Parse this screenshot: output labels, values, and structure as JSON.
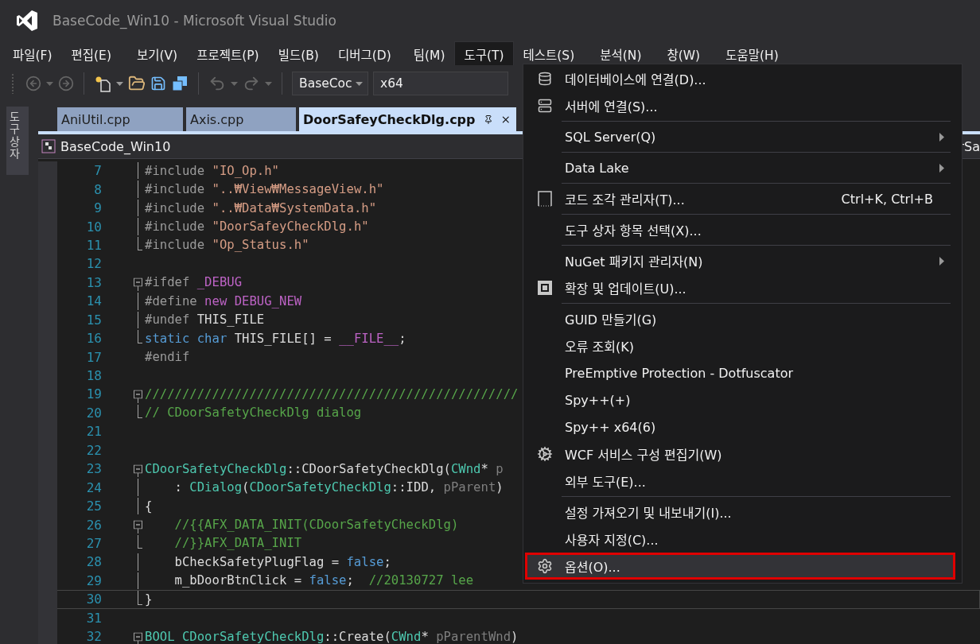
{
  "window": {
    "title": "BaseCode_Win10 - Microsoft Visual Studio"
  },
  "menu_bar": [
    {
      "label": "파일(F)",
      "selected": false
    },
    {
      "label": "편집(E)",
      "selected": false
    },
    {
      "label": "보기(V)",
      "selected": false
    },
    {
      "label": "프로젝트(P)",
      "selected": false
    },
    {
      "label": "빌드(B)",
      "selected": false
    },
    {
      "label": "디버그(D)",
      "selected": false
    },
    {
      "label": "팀(M)",
      "selected": false
    },
    {
      "label": "도구(T)",
      "selected": true
    },
    {
      "label": "테스트(S)",
      "selected": false
    },
    {
      "label": "분석(N)",
      "selected": false
    },
    {
      "label": "창(W)",
      "selected": false
    },
    {
      "label": "도움말(H)",
      "selected": false
    }
  ],
  "toolbar": {
    "solution_combo": "BaseCoc",
    "platform_combo": "x64"
  },
  "side_panel": {
    "label": "도구 상자"
  },
  "doc_tabs": [
    {
      "label": "AniUtil.cpp",
      "selected": false
    },
    {
      "label": "Axis.cpp",
      "selected": false
    },
    {
      "label": "DoorSafeyCheckDlg.cpp",
      "selected": true
    }
  ],
  "nav_bar": {
    "project": "BaseCode_Win10",
    "member": "rSa"
  },
  "code_lines": [
    {
      "number": "7",
      "kind": "mid",
      "current": false,
      "segments": [
        {
          "kind": "preproc",
          "text": "#include "
        },
        {
          "kind": "string",
          "text": "\"IO_Op.h\""
        }
      ]
    },
    {
      "number": "8",
      "kind": "mid",
      "current": false,
      "segments": [
        {
          "kind": "preproc",
          "text": "#include "
        },
        {
          "kind": "string",
          "text": "\"..₩View₩MessageView.h\""
        }
      ]
    },
    {
      "number": "9",
      "kind": "mid",
      "current": false,
      "segments": [
        {
          "kind": "preproc",
          "text": "#include "
        },
        {
          "kind": "string",
          "text": "\"..₩Data₩SystemData.h\""
        }
      ]
    },
    {
      "number": "10",
      "kind": "mid",
      "current": false,
      "segments": [
        {
          "kind": "preproc",
          "text": "#include "
        },
        {
          "kind": "string",
          "text": "\"DoorSafeyCheckDlg.h\""
        }
      ]
    },
    {
      "number": "11",
      "kind": "end",
      "current": false,
      "segments": [
        {
          "kind": "preproc",
          "text": "#include "
        },
        {
          "kind": "string",
          "text": "\"Op_Status.h\""
        }
      ]
    },
    {
      "number": "12",
      "kind": "plain",
      "current": false
    },
    {
      "number": "13",
      "kind": "start",
      "current": false,
      "segments": [
        {
          "kind": "preproc",
          "text": "#ifdef "
        },
        {
          "kind": "macro",
          "text": "_DEBUG"
        }
      ]
    },
    {
      "number": "14",
      "kind": "mid",
      "current": false,
      "segments": [
        {
          "kind": "preproc",
          "text": "#define "
        },
        {
          "kind": "macro",
          "text": "new"
        },
        {
          "kind": "macro",
          "text": " DEBUG_NEW"
        }
      ]
    },
    {
      "number": "15",
      "kind": "mid",
      "current": false,
      "segments": [
        {
          "kind": "preproc",
          "text": "#undef "
        },
        {
          "kind": "plain",
          "text": "THIS_FILE"
        }
      ]
    },
    {
      "number": "16",
      "kind": "end",
      "current": false,
      "segments": [
        {
          "kind": "keyword",
          "text": "static"
        },
        {
          "kind": "keyword",
          "text": " char"
        },
        {
          "kind": "plain",
          "text": " THIS_FILE[] = "
        },
        {
          "kind": "macro",
          "text": "__FILE__"
        },
        {
          "kind": "plain",
          "text": ";"
        }
      ]
    },
    {
      "number": "17",
      "kind": "plain",
      "current": false,
      "segments": [
        {
          "kind": "preproc",
          "text": "#endif"
        }
      ]
    },
    {
      "number": "18",
      "kind": "plain",
      "current": false
    },
    {
      "number": "19",
      "kind": "start",
      "current": false,
      "segments": [
        {
          "kind": "comment",
          "text": "//////////////////////////////////////////////////"
        }
      ]
    },
    {
      "number": "20",
      "kind": "end",
      "current": false,
      "segments": [
        {
          "kind": "comment",
          "text": "// CDoorSafetyCheckDlg dialog"
        }
      ]
    },
    {
      "number": "21",
      "kind": "plain",
      "current": false
    },
    {
      "number": "22",
      "kind": "plain",
      "current": false
    },
    {
      "number": "23",
      "kind": "start",
      "current": false,
      "segments": [
        {
          "kind": "type",
          "text": "CDoorSafetyCheckDlg"
        },
        {
          "kind": "plain",
          "text": "::CDoorSafetyCheckDlg("
        },
        {
          "kind": "type",
          "text": "CWnd"
        },
        {
          "kind": "plain",
          "text": "* "
        },
        {
          "kind": "param",
          "text": "p"
        }
      ]
    },
    {
      "number": "24",
      "kind": "mid",
      "current": false,
      "segments": [
        {
          "kind": "plain",
          "text": "    : "
        },
        {
          "kind": "type",
          "text": "CDialog"
        },
        {
          "kind": "plain",
          "text": "("
        },
        {
          "kind": "type",
          "text": "CDoorSafetyCheckDlg"
        },
        {
          "kind": "plain",
          "text": "::IDD, "
        },
        {
          "kind": "param",
          "text": "pParent"
        },
        {
          "kind": "plain",
          "text": ")"
        }
      ]
    },
    {
      "number": "25",
      "kind": "mid",
      "current": false,
      "segments": [
        {
          "kind": "plain",
          "text": "{"
        }
      ]
    },
    {
      "number": "26",
      "kind": "start",
      "current": false,
      "segments": [
        {
          "kind": "comment",
          "text": "    //{{AFX_DATA_INIT(CDoorSafetyCheckDlg)"
        }
      ]
    },
    {
      "number": "27",
      "kind": "end",
      "current": false,
      "segments": [
        {
          "kind": "comment",
          "text": "    //}}AFX_DATA_INIT"
        }
      ]
    },
    {
      "number": "28",
      "kind": "mid",
      "current": false,
      "segments": [
        {
          "kind": "plain",
          "text": "    bCheckSafetyPlugFlag = "
        },
        {
          "kind": "keyword",
          "text": "false"
        },
        {
          "kind": "plain",
          "text": ";"
        }
      ]
    },
    {
      "number": "29",
      "kind": "mid",
      "current": false,
      "segments": [
        {
          "kind": "plain",
          "text": "    m_bDoorBtnClick = "
        },
        {
          "kind": "keyword",
          "text": "false"
        },
        {
          "kind": "plain",
          "text": ";"
        },
        {
          "kind": "comment",
          "text": "  //20130727 lee"
        }
      ]
    },
    {
      "number": "30",
      "kind": "end",
      "current": true,
      "segments": [
        {
          "kind": "plain",
          "text": "}"
        }
      ]
    },
    {
      "number": "31",
      "kind": "plain",
      "current": false
    },
    {
      "number": "32",
      "kind": "start",
      "current": false,
      "segments": [
        {
          "kind": "type",
          "text": "BOOL"
        },
        {
          "kind": "type",
          "text": " CDoorSafetyCheckDlg"
        },
        {
          "kind": "plain",
          "text": "::Create("
        },
        {
          "kind": "type",
          "text": "CWnd"
        },
        {
          "kind": "plain",
          "text": "* "
        },
        {
          "kind": "param",
          "text": "pParentWnd"
        },
        {
          "kind": "plain",
          "text": ")"
        }
      ]
    }
  ],
  "tools_menu": {
    "items": [
      {
        "label": "데이터베이스에 연결(D)...",
        "kind": "database",
        "separator_before": false,
        "submenu": false,
        "selected": false,
        "annotated": false
      },
      {
        "label": "서버에 연결(S)...",
        "kind": "server",
        "separator_before": false,
        "submenu": false,
        "selected": false,
        "annotated": false
      },
      {
        "label": "SQL Server(Q)",
        "kind": "plain",
        "separator_before": true,
        "submenu": true,
        "selected": false,
        "annotated": false
      },
      {
        "label": "Data Lake",
        "kind": "plain",
        "separator_before": true,
        "submenu": true,
        "selected": false,
        "annotated": false
      },
      {
        "label": "코드 조각 관리자(T)...",
        "shortcut": "Ctrl+K, Ctrl+B",
        "kind": "snippet",
        "separator_before": true,
        "submenu": false,
        "selected": false,
        "annotated": false
      },
      {
        "label": "도구 상자 항목 선택(X)...",
        "kind": "plain",
        "separator_before": true,
        "submenu": false,
        "selected": false,
        "annotated": false
      },
      {
        "label": "NuGet 패키지 관리자(N)",
        "kind": "plain",
        "separator_before": true,
        "submenu": true,
        "selected": false,
        "annotated": false
      },
      {
        "label": "확장 및 업데이트(U)...",
        "kind": "extensions",
        "separator_before": false,
        "submenu": false,
        "selected": false,
        "annotated": false
      },
      {
        "label": "GUID 만들기(G)",
        "kind": "plain",
        "separator_before": true,
        "submenu": false,
        "selected": false,
        "annotated": false
      },
      {
        "label": "오류 조회(K)",
        "kind": "plain",
        "separator_before": false,
        "submenu": false,
        "selected": false,
        "annotated": false
      },
      {
        "label": "PreEmptive Protection - Dotfuscator",
        "kind": "plain",
        "separator_before": false,
        "submenu": false,
        "selected": false,
        "annotated": false
      },
      {
        "label": "Spy++(+)",
        "kind": "plain",
        "separator_before": false,
        "submenu": false,
        "selected": false,
        "annotated": false
      },
      {
        "label": "Spy++ x64(6)",
        "kind": "plain",
        "separator_before": false,
        "submenu": false,
        "selected": false,
        "annotated": false
      },
      {
        "label": "WCF 서비스 구성 편집기(W)",
        "kind": "wcf",
        "separator_before": false,
        "submenu": false,
        "selected": false,
        "annotated": false
      },
      {
        "label": "외부 도구(E)...",
        "kind": "plain",
        "separator_before": false,
        "submenu": false,
        "selected": false,
        "annotated": false
      },
      {
        "label": "설정 가져오기 및 내보내기(I)...",
        "kind": "plain",
        "separator_before": true,
        "submenu": false,
        "selected": false,
        "annotated": false
      },
      {
        "label": "사용자 지정(C)...",
        "kind": "plain",
        "separator_before": false,
        "submenu": false,
        "selected": false,
        "annotated": false
      },
      {
        "label": "옵션(O)...",
        "kind": "gear",
        "separator_before": false,
        "submenu": false,
        "selected": true,
        "annotated": true
      }
    ]
  }
}
